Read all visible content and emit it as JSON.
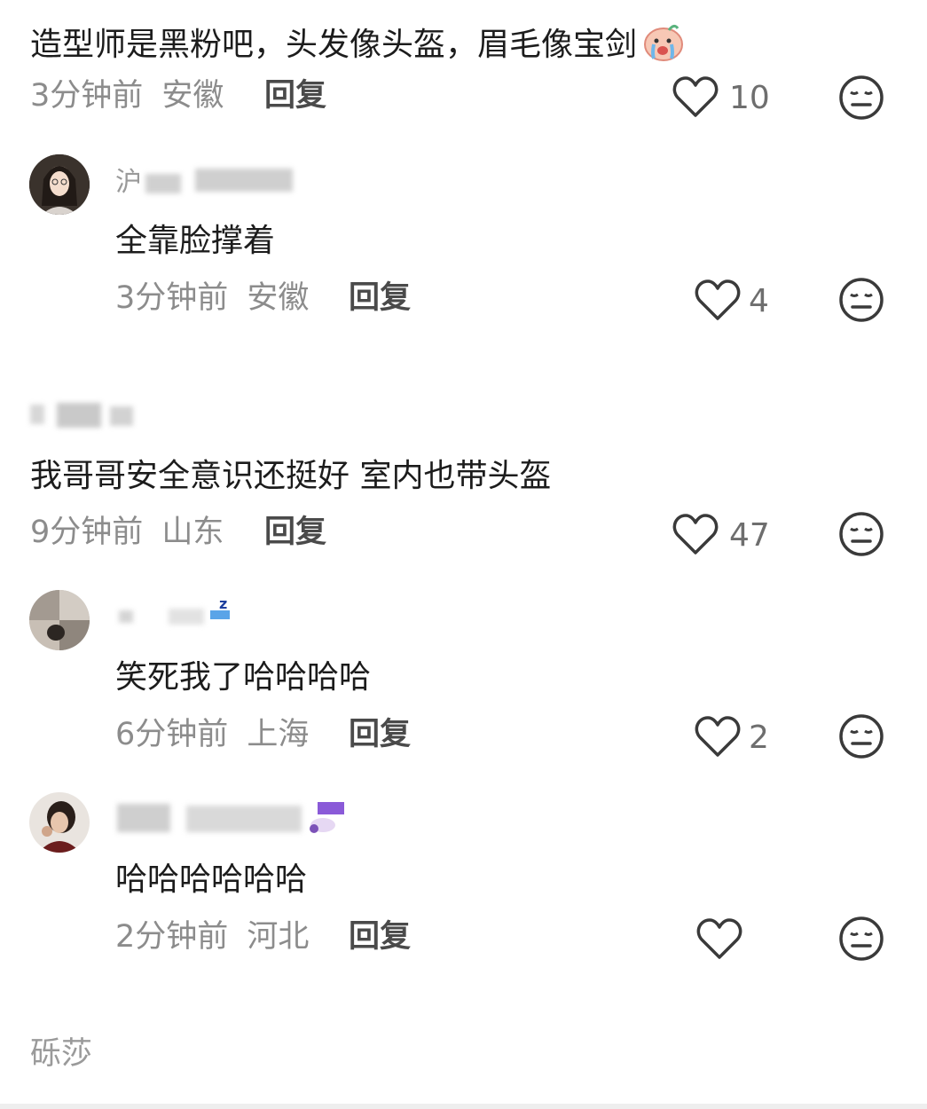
{
  "comments": [
    {
      "username": "",
      "text": "造型师是黑粉吧，头发像头盔，眉毛像宝剑",
      "time": "3分钟前",
      "location": "安徽",
      "reply_label": "回复",
      "likes": "10"
    },
    {
      "username": "沪",
      "text": "全靠脸撑着",
      "time": "3分钟前",
      "location": "安徽",
      "reply_label": "回复",
      "likes": "4"
    },
    {
      "username": "",
      "text": "我哥哥安全意识还挺好 室内也带头盔",
      "time": "9分钟前",
      "location": "山东",
      "reply_label": "回复",
      "likes": "47"
    },
    {
      "username": "",
      "text": "笑死我了哈哈哈哈",
      "time": "6分钟前",
      "location": "上海",
      "reply_label": "回复",
      "likes": "2"
    },
    {
      "username": "",
      "text": "哈哈哈哈哈哈",
      "time": "2分钟前",
      "location": "河北",
      "reply_label": "回复",
      "likes": ""
    }
  ],
  "footer": {
    "username": "砾莎"
  },
  "icons": {
    "like": "heart-icon",
    "dislike": "neutral-face-icon",
    "emoji": "crying-baby-emoji-icon"
  },
  "colors": {
    "meta": "#8c8c8c",
    "text": "#1c1c1c",
    "icon": "#3a3a3a"
  }
}
